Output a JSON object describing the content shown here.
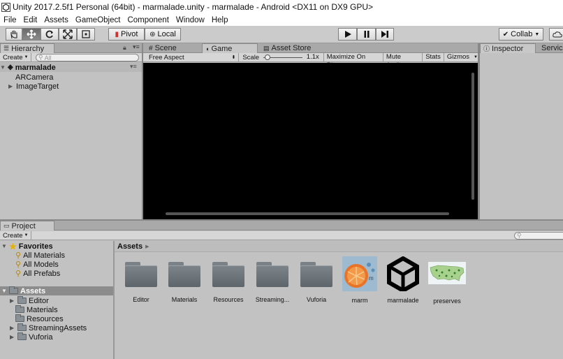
{
  "window_title": "Unity 2017.2.5f1 Personal (64bit) - marmalade.unity - marmalade - Android <DX11 on DX9 GPU>",
  "menu": [
    "File",
    "Edit",
    "Assets",
    "GameObject",
    "Component",
    "Window",
    "Help"
  ],
  "toolbar": {
    "pivot": "Pivot",
    "local": "Local",
    "collab": "Collab"
  },
  "hierarchy": {
    "tab": "Hierarchy",
    "create": "Create",
    "search_placeholder": "All",
    "scene": "marmalade",
    "items": [
      "ARCamera",
      "ImageTarget"
    ]
  },
  "center_tabs": {
    "scene": "Scene",
    "game": "Game",
    "asset_store": "Asset Store"
  },
  "game_bar": {
    "aspect": "Free Aspect",
    "scale_label": "Scale",
    "scale_value": "1.1x",
    "maximize": "Maximize On Play",
    "mute": "Mute Audio",
    "stats": "Stats",
    "gizmos": "Gizmos"
  },
  "right_tabs": {
    "inspector": "Inspector",
    "services": "Servic"
  },
  "project": {
    "tab": "Project",
    "create": "Create",
    "favorites_label": "Favorites",
    "favorites": [
      "All Materials",
      "All Models",
      "All Prefabs"
    ],
    "assets_label": "Assets",
    "folders": [
      {
        "name": "Editor",
        "expandable": true
      },
      {
        "name": "Materials",
        "expandable": false
      },
      {
        "name": "Resources",
        "expandable": false
      },
      {
        "name": "StreamingAssets",
        "expandable": true
      },
      {
        "name": "Vuforia",
        "expandable": true
      }
    ],
    "breadcrumb": "Assets",
    "grid_items": [
      {
        "name": "Editor",
        "kind": "folder"
      },
      {
        "name": "Materials",
        "kind": "folder"
      },
      {
        "name": "Resources",
        "kind": "folder"
      },
      {
        "name": "Streaming...",
        "kind": "folder"
      },
      {
        "name": "Vuforia",
        "kind": "folder"
      },
      {
        "name": "marm",
        "kind": "image"
      },
      {
        "name": "marmalade",
        "kind": "unity-scene"
      },
      {
        "name": "preserves",
        "kind": "map-image"
      }
    ]
  }
}
